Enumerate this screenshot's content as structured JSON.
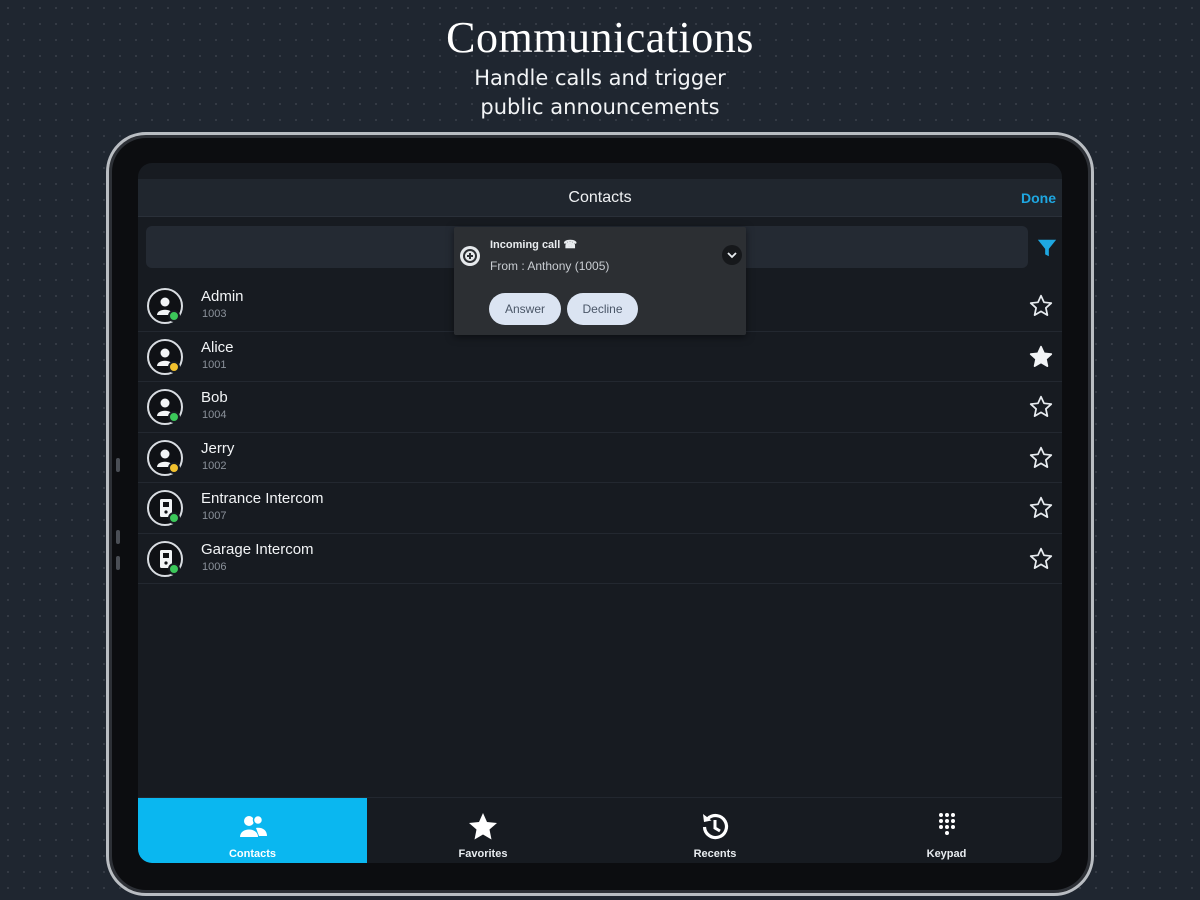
{
  "promo": {
    "title": "Communications",
    "subtitle_line1": "Handle calls and trigger",
    "subtitle_line2": "public announcements"
  },
  "header": {
    "title": "Contacts",
    "done_label": "Done"
  },
  "notification": {
    "title": "Incoming call ☎",
    "from": "From : Anthony (1005)",
    "answer_label": "Answer",
    "decline_label": "Decline"
  },
  "contacts": [
    {
      "name": "Admin",
      "ext": "1003",
      "type": "person",
      "status": "online",
      "favorite": false
    },
    {
      "name": "Alice",
      "ext": "1001",
      "type": "person",
      "status": "away",
      "favorite": true
    },
    {
      "name": "Bob",
      "ext": "1004",
      "type": "person",
      "status": "online",
      "favorite": false
    },
    {
      "name": "Jerry",
      "ext": "1002",
      "type": "person",
      "status": "away",
      "favorite": false
    },
    {
      "name": "Entrance Intercom",
      "ext": "1007",
      "type": "intercom",
      "status": "online",
      "favorite": false
    },
    {
      "name": "Garage Intercom",
      "ext": "1006",
      "type": "intercom",
      "status": "online",
      "favorite": false
    }
  ],
  "tabs": [
    {
      "label": "Contacts",
      "icon": "contacts-icon",
      "active": true
    },
    {
      "label": "Favorites",
      "icon": "star-icon",
      "active": false
    },
    {
      "label": "Recents",
      "icon": "recents-icon",
      "active": false
    },
    {
      "label": "Keypad",
      "icon": "keypad-icon",
      "active": false
    }
  ],
  "colors": {
    "accent": "#0ab7f0",
    "link": "#1ea7e1",
    "status_online": "#3cc85a",
    "status_away": "#f2c12e"
  }
}
